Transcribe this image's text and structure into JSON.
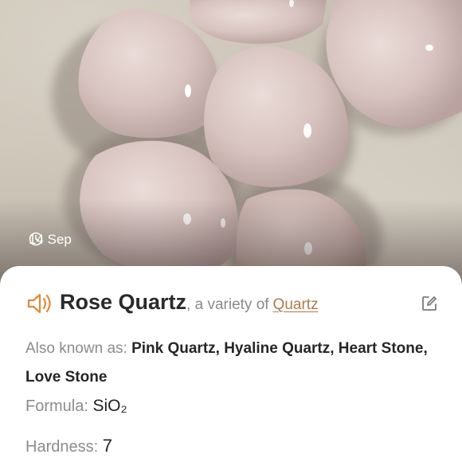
{
  "photo": {
    "date": "14 Sep",
    "date_icon": "clock-icon",
    "subject": "rose quartz heart stones"
  },
  "mineral": {
    "name": "Rose Quartz",
    "variety_prefix": ", a variety of",
    "parent_link": "Quartz",
    "audio_icon": "speaker-icon",
    "edit_icon": "edit-icon",
    "also_known_label": "Also known as:",
    "also_known_value": "Pink Quartz, Hyaline Quartz, Heart Stone, Love Stone",
    "formula_label": "Formula:",
    "formula_value": "SiO₂",
    "hardness_label": "Hardness:",
    "hardness_value": "7"
  },
  "colors": {
    "link": "#b07a4a",
    "accent_icon": "#e08a3a",
    "label": "#8c8c8c",
    "text": "#2a2a2a"
  }
}
